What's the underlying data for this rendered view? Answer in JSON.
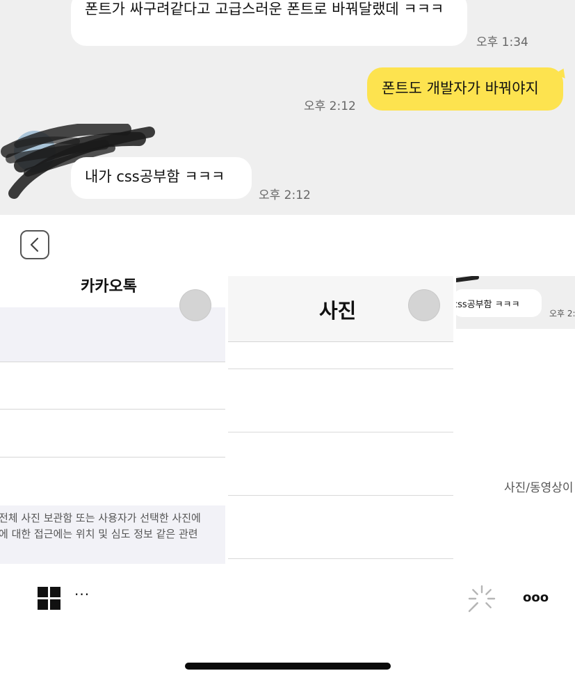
{
  "chat": {
    "messages": [
      {
        "text": "폰트가 싸구려같다고 고급스러운 폰트로 바꿔달랬데 ㅋㅋㅋ",
        "time": "오후 1:34",
        "mine": false
      },
      {
        "text": "폰트도 개발자가 바꿔야지",
        "time": "오후 2:12",
        "mine": true
      },
      {
        "text": "내가 css공부함 ㅋㅋㅋ",
        "time": "오후 2:12",
        "mine": false
      }
    ],
    "bubble_color_mine": "#fde34f",
    "bubble_color_other": "#ffffff",
    "background": "#efefef"
  },
  "back_button": {
    "icon": "chevron-left-icon"
  },
  "app_cards": {
    "kakao": {
      "title": "카카오톡",
      "footer_line1": "전체 사진 보관함 또는 사용자가 선택한 사진에",
      "footer_line2": "에 대한 접근에는 위치 및 심도 정보 같은 관련"
    },
    "photos": {
      "title": "사진"
    },
    "chat_preview": {
      "bubble": "css공부함 ㅋㅋㅋ",
      "time": "오후 2:",
      "label": "사진/동영상이"
    }
  },
  "toolbar": {
    "grid_icon": "grid-icon",
    "ellipsis": "···",
    "loading_icon": "spinner-icon",
    "more_label": "ooo"
  }
}
